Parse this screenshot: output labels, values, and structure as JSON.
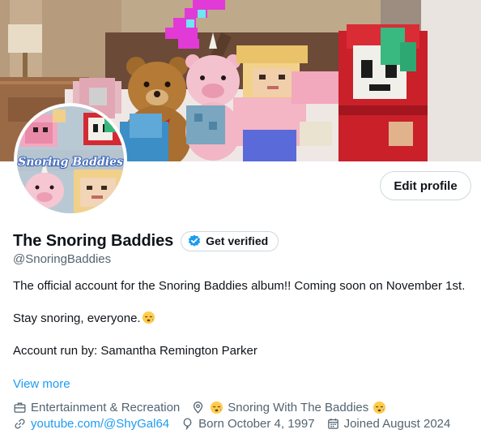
{
  "profile": {
    "display_name": "The Snoring Baddies",
    "handle": "@SnoringBaddies",
    "verify_label": "Get verified",
    "edit_label": "Edit profile",
    "avatar_text": "Snoring Baddies",
    "bio": [
      "The official account for the Snoring Baddies album!! Coming soon on November 1st.",
      "",
      "Stay snoring, everyone.",
      "",
      "Account run by: Samantha Remington Parker"
    ],
    "view_more_label": "View more",
    "meta": {
      "category": "Entertainment & Recreation",
      "location": "Snoring With The Baddies",
      "website": "youtube.com/@ShyGal64",
      "birthday": "Born October 4, 1997",
      "joined": "Joined August 2024"
    },
    "icons": [
      "briefcase-icon",
      "location-pin-icon",
      "sleepy-face-emoji",
      "link-icon",
      "balloon-icon",
      "calendar-icon",
      "verified-badge-icon"
    ]
  },
  "colors": {
    "link": "#1d9bf0",
    "text": "#0f1419",
    "secondary": "#536471",
    "border": "#cfd9de"
  }
}
